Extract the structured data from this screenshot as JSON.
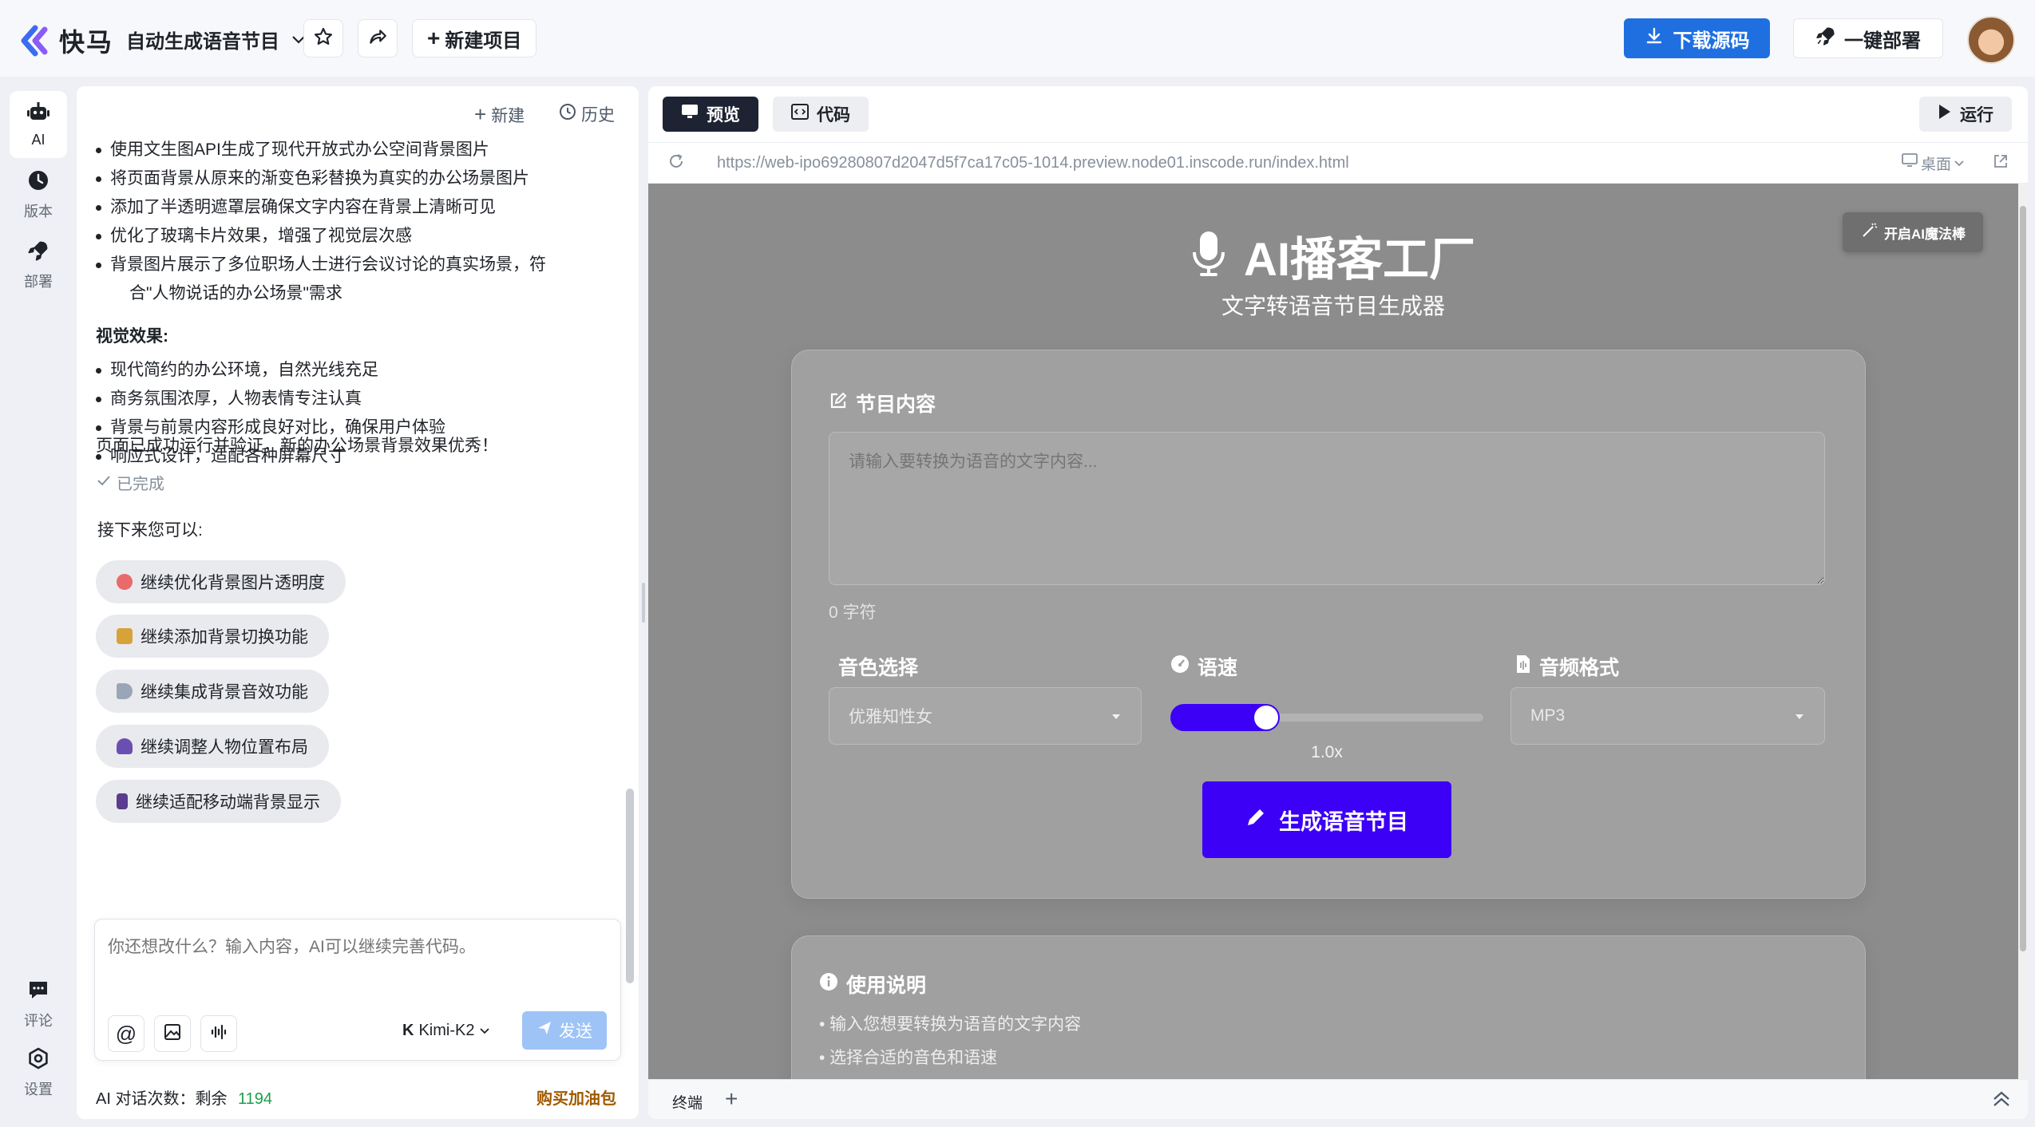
{
  "topbar": {
    "logo_text": "快马",
    "project_title": "自动生成语音节目",
    "new_project_label": "新建项目",
    "download_label": "下载源码",
    "deploy_label": "一键部署",
    "accent": "#1f6fe0"
  },
  "leftnav": {
    "items": [
      {
        "label": "AI",
        "icon": "robot-icon"
      },
      {
        "label": "版本",
        "icon": "clock-icon"
      },
      {
        "label": "部署",
        "icon": "rocket-icon"
      },
      {
        "label": "评论",
        "icon": "comment-icon"
      },
      {
        "label": "设置",
        "icon": "gear-icon"
      }
    ]
  },
  "chat": {
    "new_label": "新建",
    "history_label": "历史",
    "bullets_top": [
      "使用文生图API生成了现代开放式办公空间背景图片",
      "将页面背景从原来的渐变色彩替换为真实的办公场景图片",
      "添加了半透明遮罩层确保文字内容在背景上清晰可见",
      "优化了玻璃卡片效果，增强了视觉层次感",
      "背景图片展示了多位职场人士进行会议讨论的真实场景，符",
      "合\"人物说话的办公场景\"需求"
    ],
    "visual_heading": "视觉效果:",
    "visual_bullets": [
      "现代简约的办公环境，自然光线充足",
      "商务氛围浓厚，人物表情专注认真",
      "背景与前景内容形成良好对比，确保用户体验",
      "响应式设计，适配各种屏幕尺寸"
    ],
    "summary": "页面已成功运行并验证，新的办公场景背景效果优秀！",
    "done_label": "已完成",
    "next_heading": "接下来您可以:",
    "suggestions": [
      {
        "label": "继续优化背景图片透明度",
        "color": "#e86a6a"
      },
      {
        "label": "继续添加背景切换功能",
        "color": "#d8a23a"
      },
      {
        "label": "继续集成背景音效功能",
        "color": "#9aa6b8"
      },
      {
        "label": "继续调整人物位置布局",
        "color": "#6b4fb0"
      },
      {
        "label": "继续适配移动端背景显示",
        "color": "#5a3d8c"
      }
    ],
    "input_placeholder": "你还想改什么？输入内容，AI可以继续完善代码。",
    "model_label": "Kimi-K2",
    "send_label": "发送",
    "quota_label": "AI 对话次数：剩余",
    "quota_value": "1194",
    "buy_label": "购买加油包"
  },
  "preview": {
    "tab_preview": "预览",
    "tab_code": "代码",
    "run_label": "运行",
    "url": "https://web-ipo69280807d2047d5f7ca17c05-1014.preview.node01.inscode.run/index.html",
    "device_label": "桌面",
    "terminal_label": "终端"
  },
  "app": {
    "magic_label": "开启AI魔法棒",
    "title": "AI播客工厂",
    "subtitle": "文字转语音节目生成器",
    "content_label": "节目内容",
    "textarea_placeholder": "请输入要转换为语音的文字内容...",
    "char_count": "0 字符",
    "voice_label": "音色选择",
    "voice_value": "优雅知性女",
    "speed_label": "语速",
    "speed_value": "1.0x",
    "speed_fill": 0.35,
    "format_label": "音频格式",
    "format_value": "MP3",
    "generate_label": "生成语音节目",
    "generate_color": "#3b00f5",
    "help_title": "使用说明",
    "help_items": [
      "• 输入您想要转换为语音的文字内容",
      "• 选择合适的音色和语速"
    ]
  }
}
